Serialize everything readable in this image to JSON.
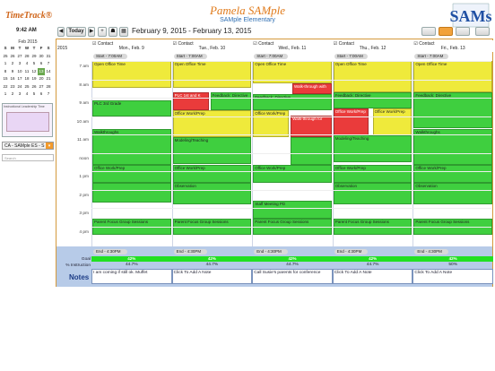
{
  "app": {
    "brand": "TimeTrack®",
    "user": "Pamela SAMple",
    "school": "SAMple Elementary",
    "clock": "9:42 AM",
    "logo_text": "SAMs"
  },
  "toolbar": {
    "today_label": "Today",
    "date_range": "February 9, 2015 - February 13, 2015"
  },
  "calendar": {
    "month": "Feb 2015",
    "weekdays": [
      "S",
      "M",
      "T",
      "W",
      "T",
      "F",
      "S"
    ],
    "weeks": [
      [
        "25",
        "26",
        "27",
        "28",
        "29",
        "30",
        "31"
      ],
      [
        "1",
        "2",
        "3",
        "4",
        "5",
        "6",
        "7"
      ],
      [
        "8",
        "9",
        "10",
        "11",
        "12",
        "13",
        "14"
      ],
      [
        "15",
        "16",
        "17",
        "18",
        "19",
        "20",
        "21"
      ],
      [
        "22",
        "23",
        "24",
        "25",
        "26",
        "27",
        "28"
      ],
      [
        "1",
        "2",
        "3",
        "4",
        "5",
        "6",
        "7"
      ]
    ],
    "selected": "13"
  },
  "thumbnail": {
    "caption": "Instructional Leadership Time"
  },
  "school_select": {
    "value": "CA - SAMple ES - S"
  },
  "search": {
    "placeholder": "Search"
  },
  "grid": {
    "year": "2015",
    "contact_label": "Contact",
    "start_label": "Start - 7:00AM",
    "end_label": "End - 4:30PM",
    "days": [
      "Mon., Feb. 9",
      "Tue., Feb. 10",
      "Wed., Feb. 11",
      "Thu., Feb. 12",
      "Fri., Feb. 13"
    ],
    "hours": [
      "7 am",
      "8 am",
      "9 am",
      "10 am",
      "11 am",
      "noon",
      "1 pm",
      "2 pm",
      "3 pm",
      "4 pm"
    ],
    "events": [
      [
        {
          "t": "Open Office Time",
          "c": "yellow"
        },
        {
          "t": "PLC 3rd Grade",
          "c": "green"
        },
        {
          "t": "Walkthroughs",
          "c": "green"
        },
        {
          "t": "Office Work/Prep",
          "c": "green"
        },
        {
          "t": "",
          "c": "green"
        },
        {
          "t": "Parent Focus Group Sessions",
          "c": "green"
        }
      ],
      [
        {
          "t": "Open Office Time",
          "c": "yellow"
        },
        {
          "t": "PLC 1st and K",
          "c": "red"
        },
        {
          "t": "Feedback: Directive",
          "c": "green"
        },
        {
          "t": "Office Work/Prep",
          "c": "yellow"
        },
        {
          "t": "Modeling/Teaching",
          "c": "green"
        },
        {
          "t": "Office Work/Prep",
          "c": "green"
        },
        {
          "t": "Observation",
          "c": "green"
        },
        {
          "t": "Parent Focus Group Sessions",
          "c": "green"
        }
      ],
      [
        {
          "t": "Open Office Time",
          "c": "yellow"
        },
        {
          "t": "Walk-through with",
          "c": "red"
        },
        {
          "t": "Feedback: Directive",
          "c": "green"
        },
        {
          "t": "Office Work/Prep",
          "c": "yellow"
        },
        {
          "t": "Walk-through for",
          "c": "red"
        },
        {
          "t": "",
          "c": "green"
        },
        {
          "t": "Office Work/Prep",
          "c": "green"
        },
        {
          "t": "Staff Meeting PD",
          "c": "green"
        },
        {
          "t": "Parent Focus Group Sessions",
          "c": "green"
        }
      ],
      [
        {
          "t": "Open Office Time",
          "c": "yellow"
        },
        {
          "t": "Feedback: Directive",
          "c": "green"
        },
        {
          "t": "Office Work/Prep",
          "c": "red"
        },
        {
          "t": "Office Work/Prep",
          "c": "yellow"
        },
        {
          "t": "Modeling/Teaching",
          "c": "green"
        },
        {
          "t": "Office Work/Prep",
          "c": "green"
        },
        {
          "t": "Observation",
          "c": "green"
        },
        {
          "t": "Parent Focus Group Sessions",
          "c": "green"
        }
      ],
      [
        {
          "t": "Open Office Time",
          "c": "yellow"
        },
        {
          "t": "Feedback: Directive",
          "c": "green"
        },
        {
          "t": "Walkthroughs",
          "c": "green"
        },
        {
          "t": "Office Work/Prep",
          "c": "green"
        },
        {
          "t": "Observation",
          "c": "green"
        },
        {
          "t": "Parent Focus Group Sessions",
          "c": "green"
        }
      ]
    ],
    "goal_label": "Goal",
    "goal": [
      "42%",
      "42%",
      "42%",
      "42%",
      "42%"
    ],
    "pct_label": "% Instruction",
    "pct": [
      "44.7%",
      "44.7%",
      "44.7%",
      "44.7%",
      "50%"
    ],
    "notes_label": "Notes",
    "notes": [
      "I am coming if still ok. Muffet",
      "Click To Add A Note",
      "Call Susie's parents for conference",
      "Click To Add A Note",
      "Click To Add A Note"
    ]
  }
}
